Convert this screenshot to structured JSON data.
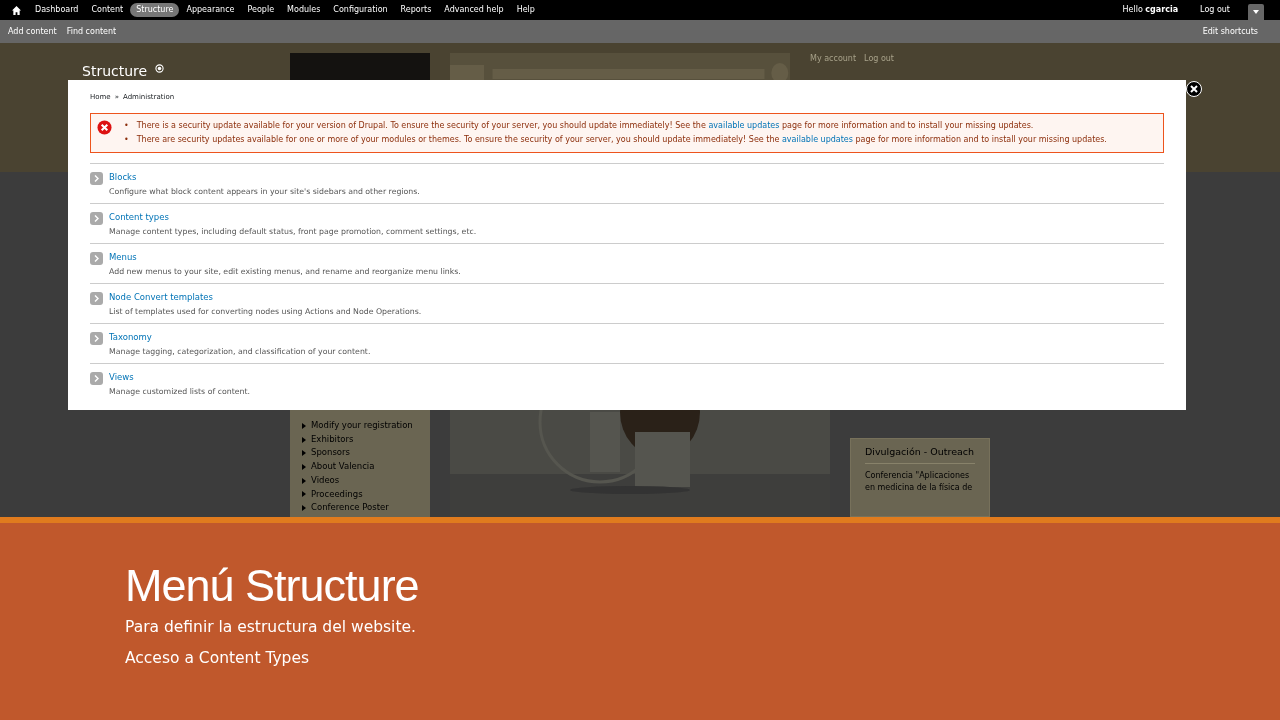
{
  "toolbar": {
    "menu": [
      {
        "label": "Dashboard",
        "selected": false
      },
      {
        "label": "Content",
        "selected": false
      },
      {
        "label": "Structure",
        "selected": true
      },
      {
        "label": "Appearance",
        "selected": false
      },
      {
        "label": "People",
        "selected": false
      },
      {
        "label": "Modules",
        "selected": false
      },
      {
        "label": "Configuration",
        "selected": false
      },
      {
        "label": "Reports",
        "selected": false
      },
      {
        "label": "Advanced help",
        "selected": false
      },
      {
        "label": "Help",
        "selected": false
      }
    ],
    "greeting": "Hello **cgarcia**",
    "logout": "Log out"
  },
  "shortcuts": {
    "links": [
      "Add content",
      "Find content"
    ],
    "edit": "Edit shortcuts"
  },
  "site": {
    "page_title": "Structure",
    "user_links": [
      "My account",
      "Log out"
    ],
    "sidebar_links": [
      "Modify your registration",
      "Exhibitors",
      "Sponsors",
      "About Valencia",
      "Videos",
      "Proceedings",
      "Conference Poster"
    ],
    "block_title": "Divulgación - Outreach",
    "block_item": "Conferencia \"Aplicaciones en medicina de la física de"
  },
  "overlay": {
    "breadcrumb": [
      "Home",
      "Administration"
    ],
    "breadcrumb_sep": "»",
    "messages": [
      {
        "marker": "•",
        "before": "There is a security update available for your version of Drupal. To ensure the security of your server, you should update immediately! See the",
        "link": "available updates",
        "after": "page for more information and to install your missing updates."
      },
      {
        "marker": "•",
        "before": "There are security updates available for one or more of your modules or themes. To ensure the security of your server, you should update immediately! See the",
        "link": "available updates",
        "after": "page for more information and to install your missing updates."
      }
    ],
    "items": [
      {
        "title": "Blocks",
        "description": "Configure what block content appears in your site's sidebars and other regions."
      },
      {
        "title": "Content types",
        "description": "Manage content types, including default status, front page promotion, comment settings, etc."
      },
      {
        "title": "Menus",
        "description": "Add new menus to your site, edit existing menus, and rename and reorganize menu links."
      },
      {
        "title": "Node Convert templates",
        "description": "List of templates used for converting nodes using Actions and Node Operations."
      },
      {
        "title": "Taxonomy",
        "description": "Manage tagging, categorization, and classification of your content."
      },
      {
        "title": "Views",
        "description": "Manage customized lists of content."
      }
    ]
  },
  "slide": {
    "title": "Menú Structure",
    "bullets": [
      "Para definir la estructura del website.",
      "Acceso a Content Types"
    ]
  }
}
